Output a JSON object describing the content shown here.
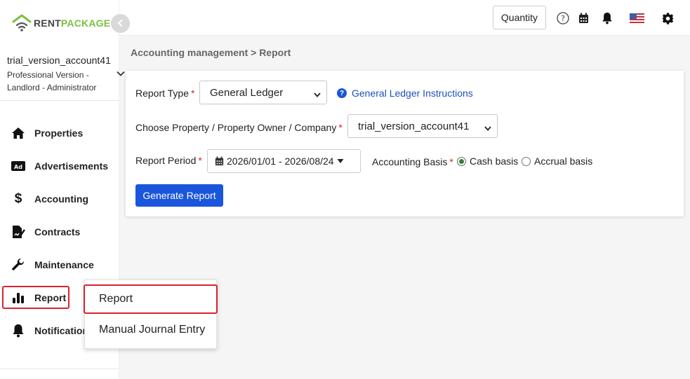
{
  "brand": {
    "name_part1": "RENT",
    "name_part2": "PACKAGE",
    "color_primary": "#7bc043"
  },
  "account": {
    "name": "trial_version_account41",
    "plan_line1": "Professional Version -",
    "plan_line2": "Landlord - Administrator"
  },
  "sidebar": {
    "items": [
      {
        "label": "Properties",
        "icon": "home-icon"
      },
      {
        "label": "Advertisements",
        "icon": "ad-icon"
      },
      {
        "label": "Accounting",
        "icon": "dollar-icon"
      },
      {
        "label": "Contracts",
        "icon": "contract-icon"
      },
      {
        "label": "Maintenance",
        "icon": "wrench-icon"
      },
      {
        "label": "Report",
        "icon": "bar-chart-icon"
      },
      {
        "label": "Notifications",
        "icon": "bell-icon"
      }
    ]
  },
  "topbar": {
    "quantity_label": "Quantity",
    "icons": [
      "help-icon",
      "calendar-icon",
      "bell-icon",
      "us-flag-icon",
      "gear-icon"
    ]
  },
  "breadcrumb": "Accounting management > Report",
  "form": {
    "report_type_label": "Report Type",
    "report_type_value": "General Ledger",
    "instructions_link": "General Ledger Instructions",
    "property_label": "Choose Property / Property Owner / Company",
    "property_value": "trial_version_account41",
    "period_label": "Report Period",
    "period_value": "2026/01/01 - 2026/08/24",
    "basis_label": "Accounting Basis",
    "basis_options": [
      "Cash basis",
      "Accrual basis"
    ],
    "basis_selected": "Cash basis",
    "generate_label": "Generate Report"
  },
  "flyout": {
    "items": [
      "Report",
      "Manual Journal Entry"
    ],
    "selected": "Report"
  },
  "colors": {
    "accent": "#1a56db",
    "required": "#d9232d",
    "highlight": "#d9232d"
  }
}
